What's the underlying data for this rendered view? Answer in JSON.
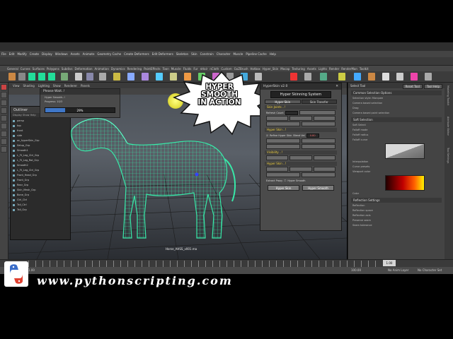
{
  "menu": {
    "items": [
      "File",
      "Edit",
      "Modify",
      "Create",
      "Display",
      "Windows",
      "Assets",
      "Animate",
      "Geometry Cache",
      "Create Deformers",
      "Edit Deformers",
      "Skeleton",
      "Skin",
      "Constrain",
      "Character",
      "Muscle",
      "Pipeline Cache",
      "Help"
    ]
  },
  "shelf": {
    "tabs": [
      "General",
      "Curves",
      "Surfaces",
      "Polygons",
      "Subdivs",
      "Deformation",
      "Animation",
      "Dynamics",
      "Rendering",
      "PaintEffects",
      "Toon",
      "Muscle",
      "Fluids",
      "Fur",
      "nHair",
      "nCloth",
      "Custom",
      "GoZBrush",
      "Hotbox",
      "Hyper_Skin",
      "Mocap",
      "Texturing",
      "Assets",
      "Lights",
      "Render",
      "RenderMan",
      "Toolkit"
    ]
  },
  "viewport": {
    "menu": [
      "View",
      "Shading",
      "Lighting",
      "Show",
      "Renderer",
      "Panels"
    ],
    "filename": "Horse_AHSS_v001.ma"
  },
  "outliner": {
    "title": "Outliner",
    "menu": "Display  Show  Help",
    "items": [
      "persp",
      "top",
      "front",
      "side",
      "ac_hyperSkin_Grp",
      "Setup_Grp",
      "Smooth1",
      "L_Ft_Leg_Ctrl_Grp",
      "L_Ft_Leg_Rot_Grp",
      "Smooth2",
      "L_Ft_Leg_Ctrl_Grp",
      "Front_Head_Grp",
      "Front_Grp",
      "Rear_Grp",
      "Skin_Mesh_Grp",
      "Bone_Grp",
      "Ctrl_Ctrl",
      "Tail_Ctrl",
      "Tail_Grp"
    ]
  },
  "please_wait": {
    "title": "Please Wait..!",
    "line1": "Hyper Smooth..!",
    "line2": "Progress: 10/3",
    "percent_label": "29%",
    "progress": 0.29
  },
  "bubble": {
    "line1": "HYPER",
    "line2": "SMOOTH",
    "line3": "IN ACTION"
  },
  "hyperskin": {
    "title": "HyperSkin v2.0",
    "logo": "Hyper Skinning System",
    "tabs": [
      "Hyper Skin",
      "Skin Transfer"
    ],
    "sections": [
      "Skin Joints ..!",
      "Hyper Skin ..!",
      "Visibility ..!",
      "Hyper Skin ..!"
    ],
    "refresh_label": "Refresh Count",
    "refine_label": "Refine Hyper Skin",
    "blend_label": "Blend Val",
    "blend_value": "0.80",
    "extract_label": "Extract Proxy",
    "hyper_smooth_label": "Hyper Smooth",
    "btn_skin": "Hyper Skin",
    "btn_smooth": "Hyper Smooth"
  },
  "tool_settings": {
    "title": "Select Tool",
    "reset_label": "Reset Tool",
    "help_label": "Tool Help",
    "sections": [
      "Common Selection Options",
      "Soft Selection",
      "Reflection Settings"
    ],
    "rows": [
      "Selection style: Marquee",
      "Camera based selection",
      "Drag",
      "Camera based paint selection",
      "Soft Select",
      "Falloff mode",
      "Falloff radius",
      "Falloff curve",
      "Interpolation",
      "Curve presets",
      "Viewport color",
      "Color",
      "Reflection",
      "Reflection space",
      "Reflection axis",
      "Preserve seam",
      "Seam tolerance"
    ],
    "side_tabs": [
      "Modeling Toolkit",
      "Attribute Editor",
      "Tool Settings"
    ]
  },
  "timeline": {
    "current_frame": "1.00",
    "start": "1.00",
    "end": "100.00",
    "anim_layer": "No Anim Layer",
    "char_set": "No Character Set"
  },
  "brand": "www.pythonscripting.com",
  "colors": {
    "mesh": "#38e8a8",
    "accent": "#3f77c8",
    "section_label": "#f0d040"
  }
}
